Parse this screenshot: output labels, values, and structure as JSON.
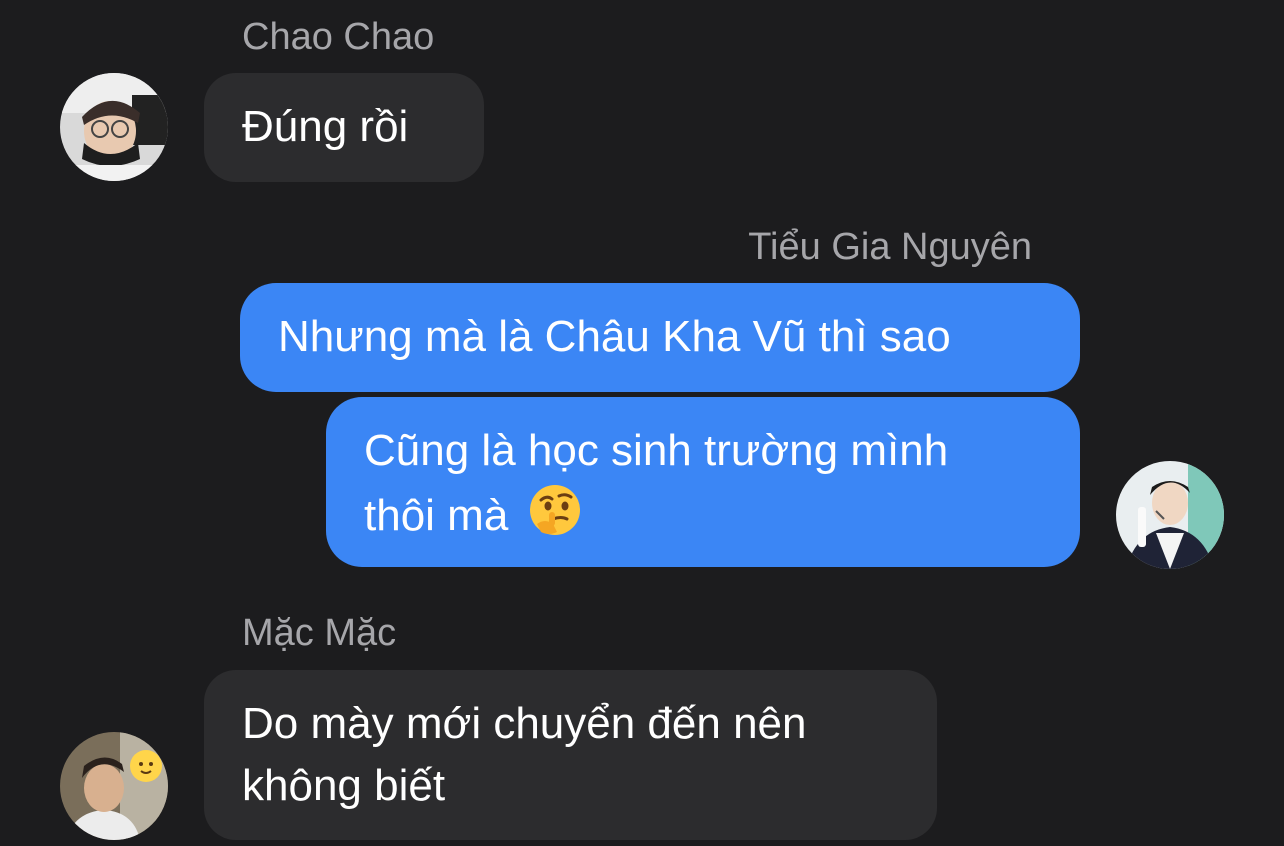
{
  "messages": [
    {
      "sender": "Chao Chao",
      "direction": "incoming",
      "text": "Đúng rồi",
      "avatar": "person-with-glasses-and-mask"
    },
    {
      "sender": "Tiểu Gia Nguyên",
      "direction": "outgoing",
      "text": "Nhưng mà là Châu Kha Vũ thì sao"
    },
    {
      "direction": "outgoing",
      "line1": "Cũng là học sinh trường mình",
      "line2": "thôi mà",
      "emoji": "thinking-face-emoji",
      "avatar": "person-in-stage-jacket-with-headset"
    },
    {
      "sender": "Mặc Mặc",
      "direction": "incoming",
      "line1": "Do mày mới chuyển đến nên",
      "line2": "không biết",
      "avatar": "person-with-sun-sticker"
    }
  ],
  "colors": {
    "background": "#1c1c1e",
    "incoming_bubble": "#2c2c2e",
    "outgoing_bubble": "#3b86f5",
    "sender_name": "#a6a6aa",
    "message_text": "#ffffff"
  }
}
